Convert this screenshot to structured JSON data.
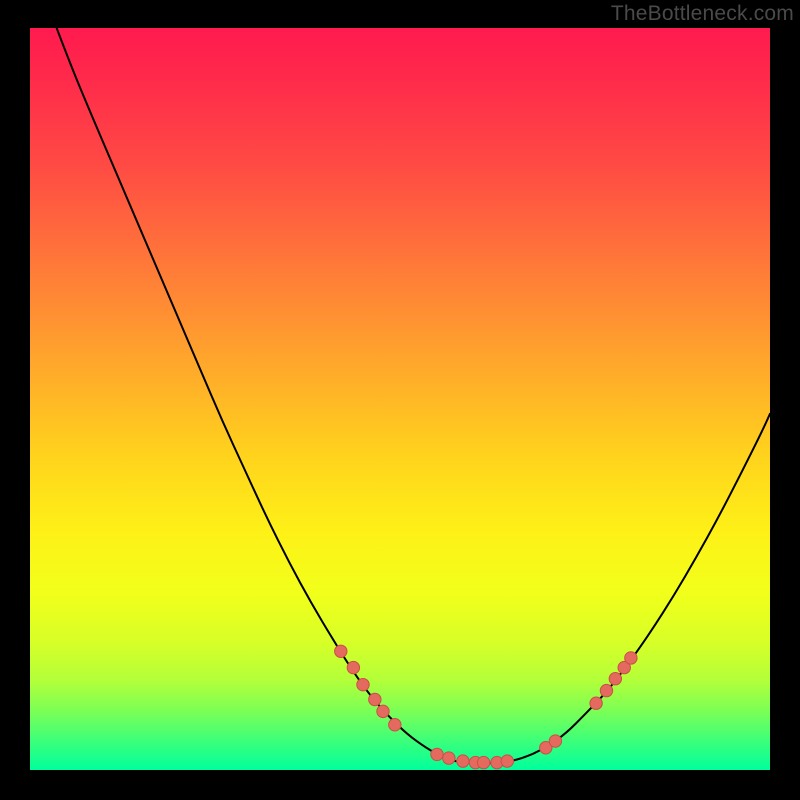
{
  "watermark": "TheBottleneck.com",
  "style": {
    "curve_stroke": "#000000",
    "curve_width": 2.0,
    "marker_fill": "#e4695e",
    "marker_stroke": "#ca4f46",
    "marker_radius": 6.2
  },
  "chart_data": {
    "type": "line",
    "title": "",
    "xlabel": "",
    "ylabel": "",
    "xlim": [
      0,
      100
    ],
    "ylim": [
      0,
      100
    ],
    "annotations": [],
    "series": [
      {
        "name": "left-curve",
        "x": [
          3.6,
          5.5,
          8,
          11,
          14,
          17,
          20,
          23,
          26,
          29,
          32,
          35,
          38,
          41,
          43.5,
          46,
          48.5,
          51,
          53.5,
          55.8,
          57.5
        ],
        "y": [
          100,
          95,
          89,
          82,
          75,
          68,
          61,
          54,
          47,
          40.5,
          34,
          28,
          22.5,
          17.5,
          13.5,
          10,
          7.2,
          4.8,
          3.0,
          1.7,
          1.2
        ]
      },
      {
        "name": "valley",
        "x": [
          57.5,
          59,
          60.5,
          62,
          63.5,
          65,
          66.5,
          68
        ],
        "y": [
          1.2,
          1.0,
          0.9,
          0.9,
          1.0,
          1.2,
          1.6,
          2.2
        ]
      },
      {
        "name": "right-curve",
        "x": [
          68,
          70,
          72.5,
          75,
          78,
          81,
          84,
          87,
          90,
          93,
          96,
          99,
          100
        ],
        "y": [
          2.2,
          3.2,
          5.0,
          7.5,
          10.6,
          14.5,
          18.8,
          23.5,
          28.6,
          34,
          39.8,
          45.8,
          48
        ]
      }
    ],
    "markers": [
      {
        "x": 42.0,
        "y": 16.0
      },
      {
        "x": 43.7,
        "y": 13.8
      },
      {
        "x": 45.0,
        "y": 11.5
      },
      {
        "x": 46.6,
        "y": 9.5
      },
      {
        "x": 47.7,
        "y": 7.9
      },
      {
        "x": 49.3,
        "y": 6.1
      },
      {
        "x": 55.0,
        "y": 2.1
      },
      {
        "x": 56.6,
        "y": 1.6
      },
      {
        "x": 58.5,
        "y": 1.2
      },
      {
        "x": 60.2,
        "y": 1.0
      },
      {
        "x": 61.3,
        "y": 1.0
      },
      {
        "x": 63.1,
        "y": 1.0
      },
      {
        "x": 64.5,
        "y": 1.2
      },
      {
        "x": 69.7,
        "y": 3.0
      },
      {
        "x": 71.0,
        "y": 3.9
      },
      {
        "x": 76.5,
        "y": 9.0
      },
      {
        "x": 77.9,
        "y": 10.7
      },
      {
        "x": 79.1,
        "y": 12.3
      },
      {
        "x": 80.3,
        "y": 13.8
      },
      {
        "x": 81.2,
        "y": 15.1
      }
    ]
  }
}
